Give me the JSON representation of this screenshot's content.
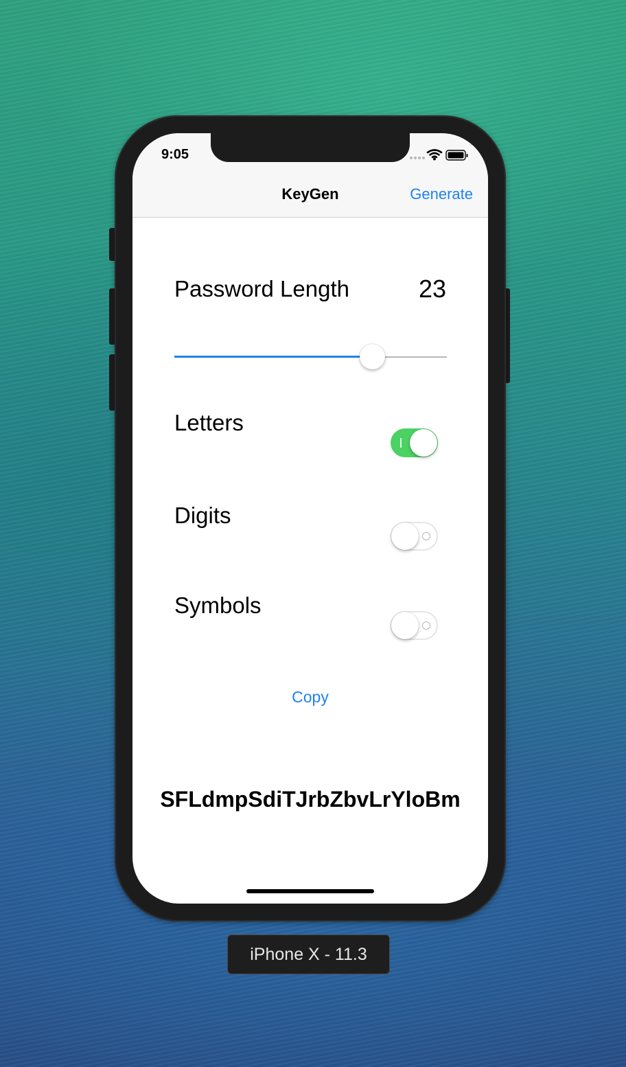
{
  "status_bar": {
    "time": "9:05",
    "icons": [
      "signal-dots-icon",
      "wifi-icon",
      "battery-icon"
    ]
  },
  "nav": {
    "title": "KeyGen",
    "right_button": "Generate"
  },
  "password_length": {
    "label": "Password Length",
    "value": "23",
    "slider_fraction": 0.725
  },
  "options": [
    {
      "label": "Letters",
      "on": true
    },
    {
      "label": "Digits",
      "on": false
    },
    {
      "label": "Symbols",
      "on": false
    }
  ],
  "copy_label": "Copy",
  "password": "SFLdmpSdiTJrbZbvLrYloBm",
  "device_caption": "iPhone X - 11.3",
  "colors": {
    "tint": "#1e82f0",
    "toggle_on": "#4bd263"
  }
}
